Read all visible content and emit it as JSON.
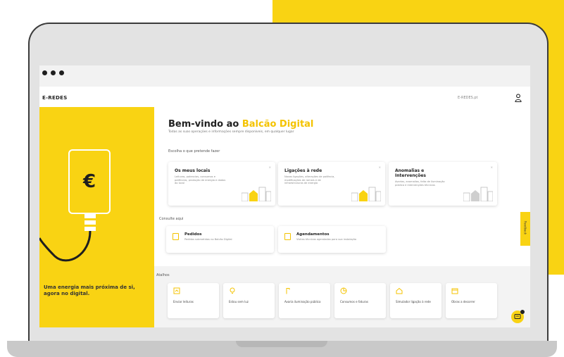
{
  "colors": {
    "accent": "#f9d313",
    "dark": "#1e1e1e",
    "frame": "#e3e3e3"
  },
  "header": {
    "brand": "E-REDES",
    "link": "E-REDES.pt",
    "user_icon": "user-icon"
  },
  "side_panel": {
    "tagline": "Uma energia mais próxima de si, agora no digital."
  },
  "welcome": {
    "title_prefix": "Bem-vindo ao ",
    "title_highlight": "Balcão Digital",
    "subtitle": "Todas as suas operações e informações sempre disponíveis, em qualquer lugar"
  },
  "choose_label": "Escolha o que pretende fazer",
  "main_cards": [
    {
      "title": "Os meus locais",
      "desc": "Leituras, potencias, consumos e potências, produção de energia e dados do local"
    },
    {
      "title": "Ligações à rede",
      "desc": "Novas ligações, alterações de potência, modificações de ramais e de infraestruturas de energia"
    },
    {
      "title": "Anomalias e Intervenções",
      "desc": "Avarias, anomalias, falta de iluminação pública e intervenções técnicas"
    }
  ],
  "consult_label": "Consulte aqui",
  "consult_cards": [
    {
      "title": "Pedidos",
      "desc": "Pedidos submetidos no Balcão Digital"
    },
    {
      "title": "Agendamentos",
      "desc": "Visitas técnicas agendadas para sua instalação"
    }
  ],
  "feedback_label": "Feedback",
  "shortcuts_label": "Atalhos",
  "shortcuts": [
    {
      "label": "Enviar leituras",
      "icon": "meter-icon"
    },
    {
      "label": "Estou sem luz",
      "icon": "bulb-icon"
    },
    {
      "label": "Avaria iluminação pública",
      "icon": "lamp-icon"
    },
    {
      "label": "Consumos e faturas",
      "icon": "chart-icon"
    },
    {
      "label": "Simulador ligação à rede",
      "icon": "home-icon"
    },
    {
      "label": "Obras a decorrer",
      "icon": "calendar-icon"
    }
  ]
}
